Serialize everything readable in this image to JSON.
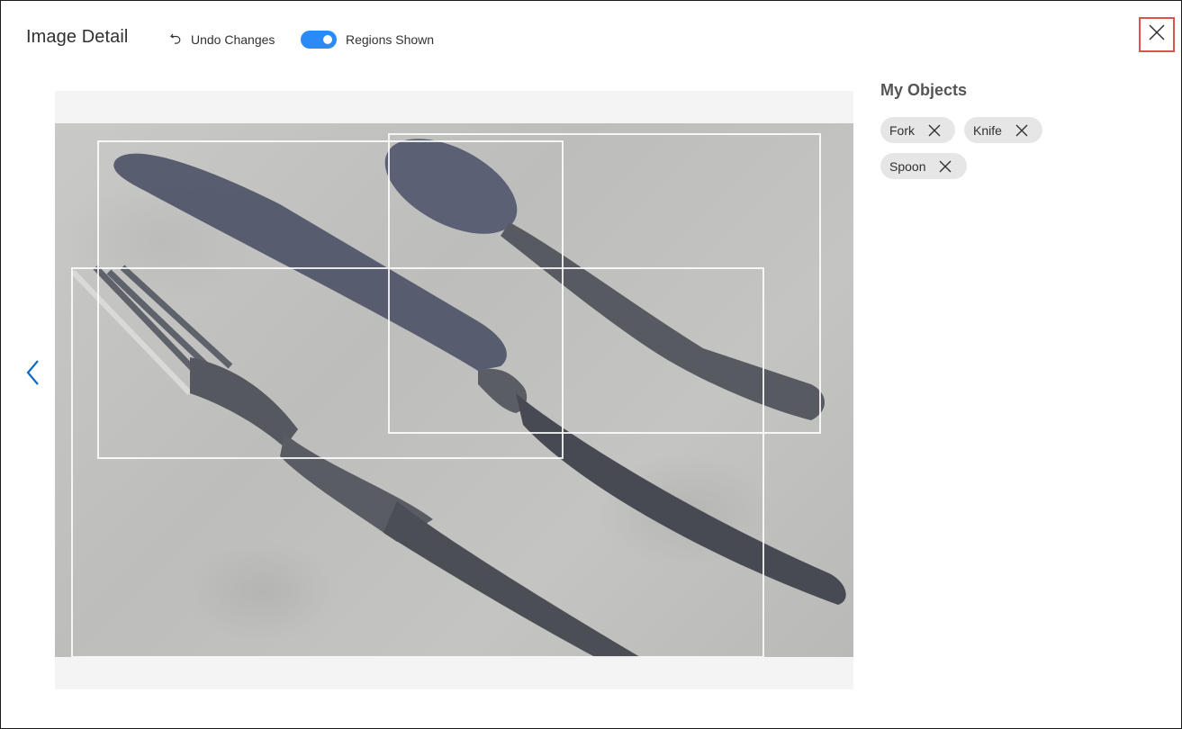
{
  "header": {
    "title": "Image Detail",
    "undo_label": "Undo Changes",
    "regions_label": "Regions Shown",
    "regions_shown": true
  },
  "icons": {
    "undo": "undo-icon",
    "close": "close-icon",
    "prev": "chevron-left-icon",
    "tag_remove": "close-icon"
  },
  "colors": {
    "toggle_on": "#2a8af6",
    "close_highlight": "#d9534f",
    "nav_arrow": "#0f6cbd"
  },
  "image": {
    "regions": [
      {
        "label": "Knife"
      },
      {
        "label": "Spoon"
      },
      {
        "label": "Fork"
      }
    ]
  },
  "sidebar": {
    "title": "My Objects",
    "tags": [
      {
        "label": "Fork"
      },
      {
        "label": "Knife"
      },
      {
        "label": "Spoon"
      }
    ]
  }
}
